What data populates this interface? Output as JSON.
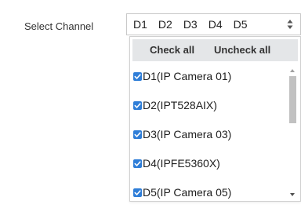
{
  "field": {
    "label": "Select Channel",
    "selected": [
      "D1",
      "D2",
      "D3",
      "D4",
      "D5"
    ]
  },
  "dropdown": {
    "check_all": "Check all",
    "uncheck_all": "Uncheck all",
    "items": [
      {
        "label": "D1(IP Camera 01)",
        "checked": true
      },
      {
        "label": "D2(IPT528AIX)",
        "checked": true
      },
      {
        "label": "D3(IP Camera 03)",
        "checked": true
      },
      {
        "label": "D4(IPFE5360X)",
        "checked": true
      },
      {
        "label": "D5(IP Camera 05)",
        "checked": true
      }
    ]
  },
  "colors": {
    "checkbox": "#2f7ed8",
    "header_bg": "#e4e6e8"
  },
  "icons": {
    "spinner": "up-down-spinner-icon",
    "checkbox": "checkbox-checked-icon",
    "scroll_up": "scroll-up-arrow-icon",
    "scroll_down": "scroll-down-arrow-icon"
  }
}
